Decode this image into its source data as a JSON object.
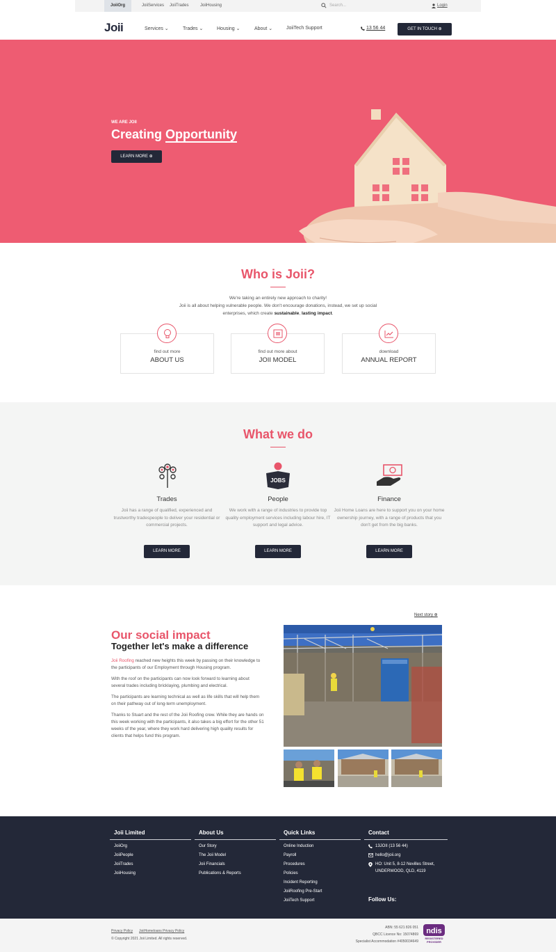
{
  "topbar": {
    "tabs": [
      "JoiiOrg",
      "JoiiServices",
      "JoiiTrades",
      "JoiiHousing"
    ],
    "search_placeholder": "Search...",
    "login": "Login"
  },
  "nav": {
    "logo": "Joii",
    "items": [
      "Services",
      "Trades",
      "Housing",
      "About",
      "JoiiTech Support"
    ],
    "phone": "13 56 44",
    "cta": "GET IN TOUCH"
  },
  "hero": {
    "kicker": "WE ARE JOII",
    "title_plain": "Creating ",
    "title_emph": "Opportunity",
    "button": "LEARN MORE"
  },
  "who": {
    "title": "Who is Joii?",
    "line1": "We're taking an entirely new approach to charity!",
    "line2": "Joii is all about helping vulnerable people. We don't encourage donations, instead, we set up social enterprises, which create ",
    "bold1": "sustainable",
    "comma": ", ",
    "bold2": "lasting impact",
    "dot": ".",
    "cards": [
      {
        "sub": "find out more",
        "title": "ABOUT US",
        "icon": "lightbulb-icon"
      },
      {
        "sub": "find out more about",
        "title": "JOII MODEL",
        "icon": "model-icon"
      },
      {
        "sub": "download",
        "title": "ANNUAL REPORT",
        "icon": "chart-icon"
      }
    ]
  },
  "what": {
    "title": "What we do",
    "services": [
      {
        "title": "Trades",
        "desc": "Joii has a range of qualified, experienced and trustworthy tradespeople to deliver your residential or commercial projects.",
        "button": "LEARN MORE"
      },
      {
        "title": "People",
        "desc": "We work with a range of industries to provide top quality employment services including labour hire, IT support and legal advice.",
        "button": "LEARN MORE"
      },
      {
        "title": "Finance",
        "desc": "Joii Home Loans are here to support you on your home ownership journey, with a range of products that you don't get from the big banks.",
        "button": "LEARN MORE"
      }
    ],
    "jobs_label": "JOBS"
  },
  "impact": {
    "next": "Next story",
    "title": "Our social impact",
    "subtitle": "Together let's make a difference",
    "p1_link": "Joii Roofing",
    "p1_rest": " reached new heights this week by passing on their knowledge to the participants of our Employment through Housing program.",
    "p2": "With the roof on the participants can now look forward to learning about several trades including bricklaying, plumbing and electrical.",
    "p3": "The participants are learning technical as well as life skills that will help them on their pathway out of long-term unemployment.",
    "p4": "Thanks to Stuart and the rest of the Joii Roofing crew. While they are hands on this week working with the participants, it also takes a big effort for the other 51 weeks of the year, where they work hard delivering high quality results for clients that helps fund this program."
  },
  "footer": {
    "cols": [
      {
        "title": "Joii Limited",
        "links": [
          "JoiiOrg",
          "JoiiPeople",
          "JoiiTrades",
          "JoiiHousing"
        ]
      },
      {
        "title": "About Us",
        "links": [
          "Our Story",
          "The Joii Model",
          "Joii Financials",
          "Publications & Reports"
        ]
      },
      {
        "title": "Quick Links",
        "links": [
          "Online Induction",
          "Payroll",
          "Procedures",
          "Policies",
          "Incident Reporting",
          "JoiiRoofing Pre-Start",
          "JoiiTech Support"
        ]
      },
      {
        "title": "Contact",
        "links": [
          "13JOII (13 56 44)",
          "hello@joii.org",
          "HO: Unit 5, 8-12 Nevilles Street,",
          "UNDERWOOD, QLD, 4119"
        ]
      }
    ],
    "follow": "Follow Us:"
  },
  "bottom": {
    "privacy": "Privacy Policy",
    "privacy2": "JoiiHomeloans Privacy Policy",
    "copyright": "© Copyright 2021 Joii Limited.  All rights reserved.",
    "abn": "ABN: 55 621 826 051",
    "qbcc": "QBCC Licence No: 15074869",
    "sda": "Specialist Accommodation #4050034649",
    "ndis": "ndis",
    "ndis_sub1": "REGISTERED",
    "ndis_sub2": "PROVIDER"
  },
  "colors": {
    "pink": "#ee5c72",
    "navy": "#232838"
  }
}
